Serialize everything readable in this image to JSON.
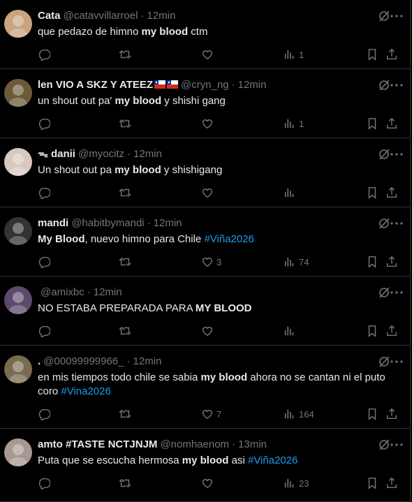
{
  "tweets": [
    {
      "name": "Cata",
      "handle": "@catavvillarroel",
      "time": "12min",
      "flags": [],
      "text": [
        {
          "t": "que pedazo de himno "
        },
        {
          "t": "my blood",
          "b": true
        },
        {
          "t": " ctm"
        }
      ],
      "likes": "",
      "views": "1",
      "avatar_color": "#c9a47e"
    },
    {
      "name": "len VIO A SKZ Y ATEEZ",
      "handle": "@cryn_ng",
      "time": "12min",
      "flags": [
        "chile-flag",
        "chile-flag"
      ],
      "text": [
        {
          "t": "un shout out pa' "
        },
        {
          "t": "my blood",
          "b": true
        },
        {
          "t": " y shishi gang"
        }
      ],
      "likes": "",
      "views": "1",
      "avatar_color": "#6b5a3a"
    },
    {
      "name": "ᯓ danii",
      "handle": "@myocitz",
      "time": "12min",
      "flags": [],
      "text": [
        {
          "t": "Un shout out pa "
        },
        {
          "t": "my blood",
          "b": true
        },
        {
          "t": " y shishigang"
        }
      ],
      "likes": "",
      "views": "",
      "avatar_color": "#d8c8c0"
    },
    {
      "name": "mandi",
      "handle": "@habitbymandi",
      "time": "12min",
      "flags": [],
      "text": [
        {
          "t": "My Blood",
          "b": true
        },
        {
          "t": ", nuevo himno para Chile "
        },
        {
          "t": "#Viña2026",
          "h": true
        }
      ],
      "likes": "3",
      "views": "74",
      "avatar_color": "#333333"
    },
    {
      "name": "",
      "handle": "@amixbc",
      "time": "12min",
      "flags": [],
      "text": [
        {
          "t": "NO ESTABA PREPARADA PARA "
        },
        {
          "t": "MY BLOOD",
          "b": true
        }
      ],
      "likes": "",
      "views": "",
      "avatar_color": "#5b4a6b"
    },
    {
      "name": ".",
      "handle": "@00099999966_",
      "time": "12min",
      "flags": [],
      "text": [
        {
          "t": "en mis tiempos todo chile se sabia "
        },
        {
          "t": "my blood",
          "b": true
        },
        {
          "t": " ahora no se cantan ni el puto coro "
        },
        {
          "t": "#Vina2026",
          "h": true
        }
      ],
      "likes": "7",
      "views": "164",
      "avatar_color": "#7a6a50"
    },
    {
      "name": "amto #TASTE NCTJNJM",
      "handle": "@nomhaenom",
      "time": "13min",
      "flags": [],
      "text": [
        {
          "t": "Puta que se escucha hermosa "
        },
        {
          "t": "my blood",
          "b": true
        },
        {
          "t": " asi "
        },
        {
          "t": "#Viña2026",
          "h": true
        }
      ],
      "likes": "",
      "views": "23",
      "avatar_color": "#a89890"
    }
  ],
  "separator": "·",
  "icons": {
    "reply": "reply-icon",
    "retweet": "retweet-icon",
    "like": "heart-icon",
    "views": "views-chart-icon",
    "bookmark": "bookmark-icon",
    "share": "share-icon",
    "grok": "grok-icon",
    "more": "more-icon"
  },
  "colors": {
    "background": "#000000",
    "text": "#e7e9ea",
    "muted": "#71767b",
    "link": "#1d9bf0",
    "border": "#2f3336"
  }
}
